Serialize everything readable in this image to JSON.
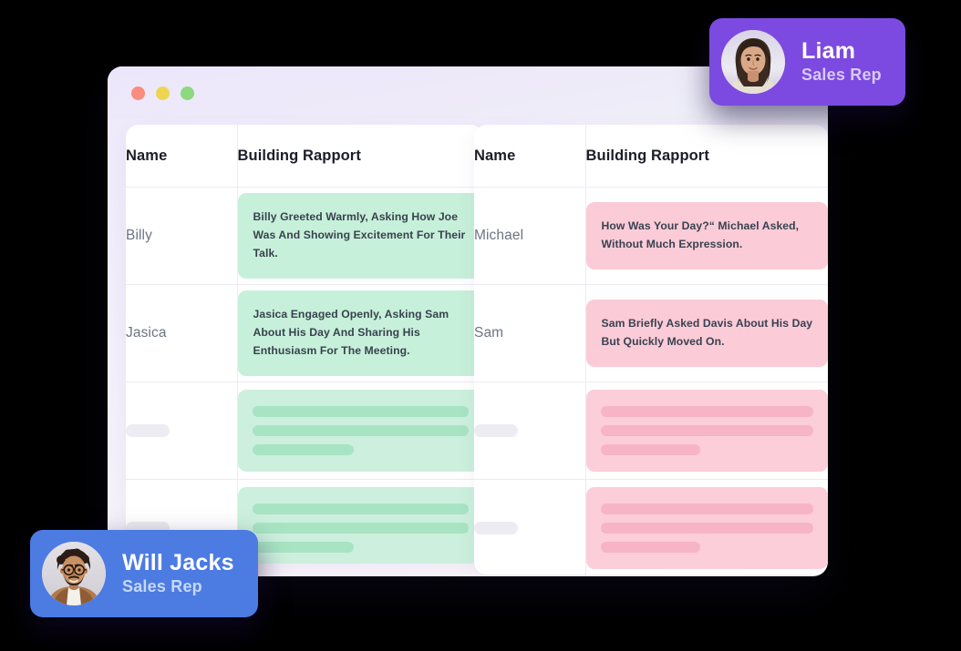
{
  "window": {
    "traffic_lights": [
      {
        "name": "close-dot",
        "color": "#f98d7e"
      },
      {
        "name": "minimize-dot",
        "color": "#edd552"
      },
      {
        "name": "maximize-dot",
        "color": "#8cd97f"
      }
    ]
  },
  "panels": [
    {
      "id": "positive-rapport-panel",
      "tone": "green",
      "columns": [
        "Name",
        "Building Rapport"
      ],
      "rows": [
        {
          "name": "Billy",
          "rapport": "Billy Greeted Warmly, Asking How Joe Was And Showing Excitement For Their Talk.",
          "placeholder": false
        },
        {
          "name": "Jasica",
          "rapport": "Jasica Engaged Openly, Asking Sam About His Day And Sharing His Enthusiasm For The Meeting.",
          "placeholder": false
        },
        {
          "name": "",
          "rapport": "",
          "placeholder": true
        },
        {
          "name": "",
          "rapport": "",
          "placeholder": true
        }
      ]
    },
    {
      "id": "neutral-rapport-panel",
      "tone": "pink",
      "columns": [
        "Name",
        "Building Rapport"
      ],
      "rows": [
        {
          "name": "Michael",
          "rapport": "How Was Your Day?“ Michael Asked, Without Much Expression.",
          "placeholder": false
        },
        {
          "name": "Sam",
          "rapport": "Sam Briefly Asked Davis About His Day But Quickly Moved On.",
          "placeholder": false
        },
        {
          "name": "",
          "rapport": "",
          "placeholder": true
        },
        {
          "name": "",
          "rapport": "",
          "placeholder": true
        }
      ]
    }
  ],
  "badges": [
    {
      "id": "liam-badge",
      "name": "Liam",
      "role": "Sales Rep",
      "color": "#7c4ae0",
      "avatar": "woman-portrait-photo"
    },
    {
      "id": "will-jacks-badge",
      "name": "Will Jacks",
      "role": "Sales Rep",
      "color": "#4c7be2",
      "avatar": "man-with-glasses-portrait-photo"
    }
  ]
}
